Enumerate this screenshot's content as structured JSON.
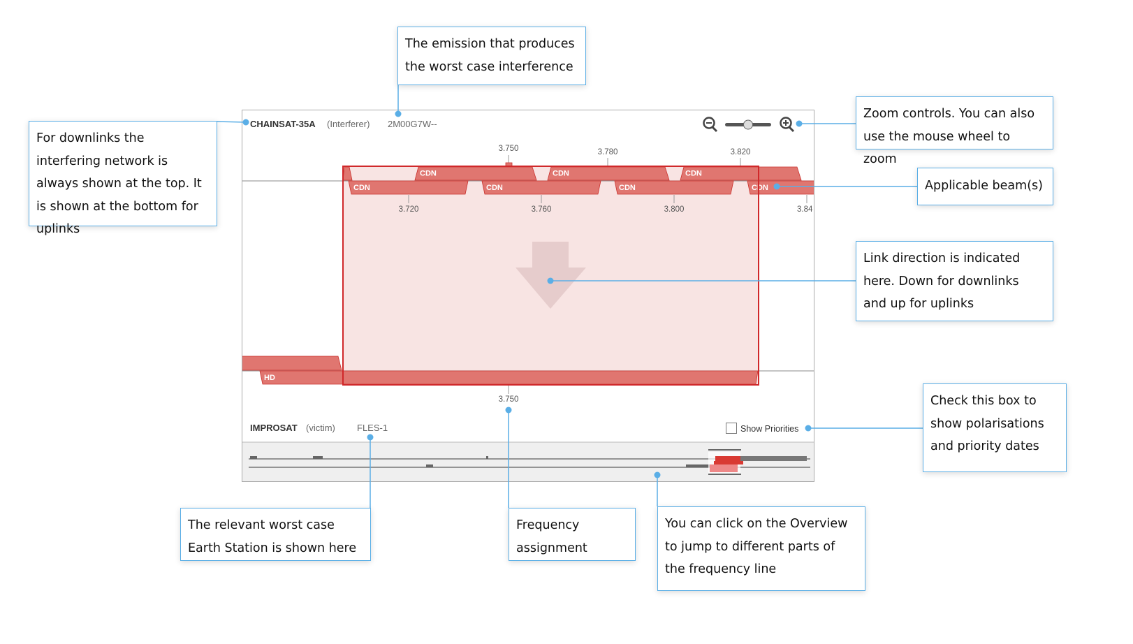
{
  "interferer": {
    "name": "CHAINSAT-35A",
    "role": "(Interferer)",
    "emission": "2M00G7W--"
  },
  "victim": {
    "name": "IMPROSAT",
    "role": "(victim)",
    "earth_station": "FLES-1"
  },
  "upper_axis": {
    "top_ticks": [
      "3.750",
      "3.780",
      "3.820"
    ],
    "bottom_ticks": [
      "3.720",
      "3.760",
      "3.800",
      "3.84"
    ]
  },
  "beams": {
    "top_row": [
      "CDN",
      "CDN",
      "CDN"
    ],
    "bottom_row": [
      "CDN",
      "CDN",
      "CDN",
      "CDN"
    ],
    "victim_beam": "HD"
  },
  "lower_axis": {
    "tick": "3.750"
  },
  "show_priorities": {
    "label": "Show Priorities",
    "checked": false
  },
  "zoom": {
    "level": 0.5
  },
  "link_direction": "down",
  "colors": {
    "band": "#e07670",
    "band_border": "#c9302c",
    "highlight_fill": "#f8e4e3",
    "highlight_border": "#d0282a",
    "callout_border": "#5aaee6",
    "arrow": "#e6cccc"
  },
  "callouts": {
    "emission": "The emission that produces the worst case interference",
    "downlinks": "For downlinks the interfering network is always shown at the top. It is shown at the bottom for uplinks",
    "zoom": "Zoom controls. You can also use the mouse wheel to zoom",
    "beams": "Applicable beam(s)",
    "direction": "Link direction is indicated here. Down for downlinks and up for uplinks",
    "priorities": "Check this box to show polarisations and priority dates",
    "earth_station": "The relevant worst case Earth Station is shown here",
    "frequency": "Frequency assignment",
    "overview": "You can click on the Overview to jump to different  parts of the frequency line"
  }
}
